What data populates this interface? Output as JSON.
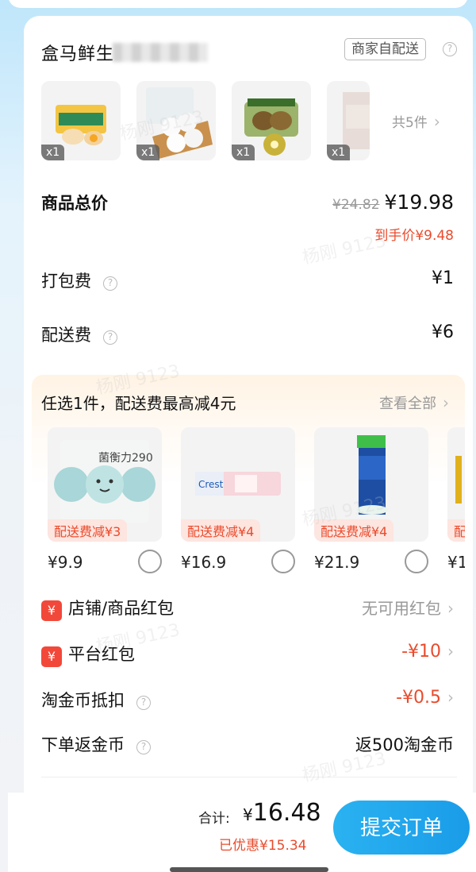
{
  "store": {
    "name": "盒马鲜生",
    "delivery_tag": "商家自配送"
  },
  "items": {
    "qty_1": "x1",
    "qty_2": "x1",
    "qty_3": "x1",
    "qty_4": "x1",
    "more": "共5件"
  },
  "summary": {
    "goods_total_label": "商品总价",
    "goods_original": "¥24.82",
    "goods_price": "¥19.98",
    "final_price": "到手价¥9.48",
    "packing_label": "打包费",
    "packing_value": "¥1",
    "shipping_label": "配送费",
    "shipping_value": "¥6"
  },
  "promo": {
    "title": "任选1件，配送费最高减4元",
    "view_all": "查看全部",
    "products": [
      {
        "badge": "配送费减¥3",
        "price": "¥9.9",
        "brand": "菌衡力290"
      },
      {
        "badge": "配送费减¥4",
        "price": "¥16.9"
      },
      {
        "badge": "配送费减¥4",
        "price": "¥21.9"
      },
      {
        "badge": "配",
        "price": "¥1"
      }
    ]
  },
  "discounts": {
    "store_label": "店铺/商品红包",
    "store_value": "无可用红包",
    "platform_label": "平台红包",
    "platform_value": "-¥10",
    "coin_label": "淘金币抵扣",
    "coin_value": "-¥0.5",
    "rebate_label": "下单返金币",
    "rebate_value": "返500淘金币",
    "rp_glyph": "¥"
  },
  "footer": {
    "total_label": "合计:",
    "total_currency": "¥",
    "total_value": "16.48",
    "saved": "已优惠¥15.34",
    "submit": "提交订单"
  },
  "watermark": "杨刚 9123",
  "colors": {
    "accent_red": "#ea4b2c",
    "submit_blue": "#1a9ce8"
  }
}
